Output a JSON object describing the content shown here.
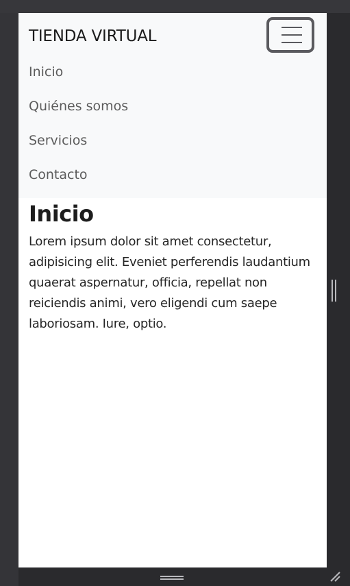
{
  "navbar": {
    "brand": "TIENDA VIRTUAL",
    "toggler_icon": "hamburger-icon",
    "items": [
      {
        "label": "Inicio"
      },
      {
        "label": "Quiénes somos"
      },
      {
        "label": "Servicios"
      },
      {
        "label": "Contacto"
      }
    ]
  },
  "main": {
    "heading": "Inicio",
    "paragraph": "Lorem ipsum dolor sit amet consectetur, adipisicing elit. Eveniet perferendis laudantium quaerat aspernatur, officia, repellat non reiciendis animi, vero eligendi cum saepe laboriosam. Iure, optio."
  },
  "colors": {
    "navbar_bg": "#f8f9fa",
    "page_bg": "#ffffff",
    "frame_bg": "#343438"
  }
}
